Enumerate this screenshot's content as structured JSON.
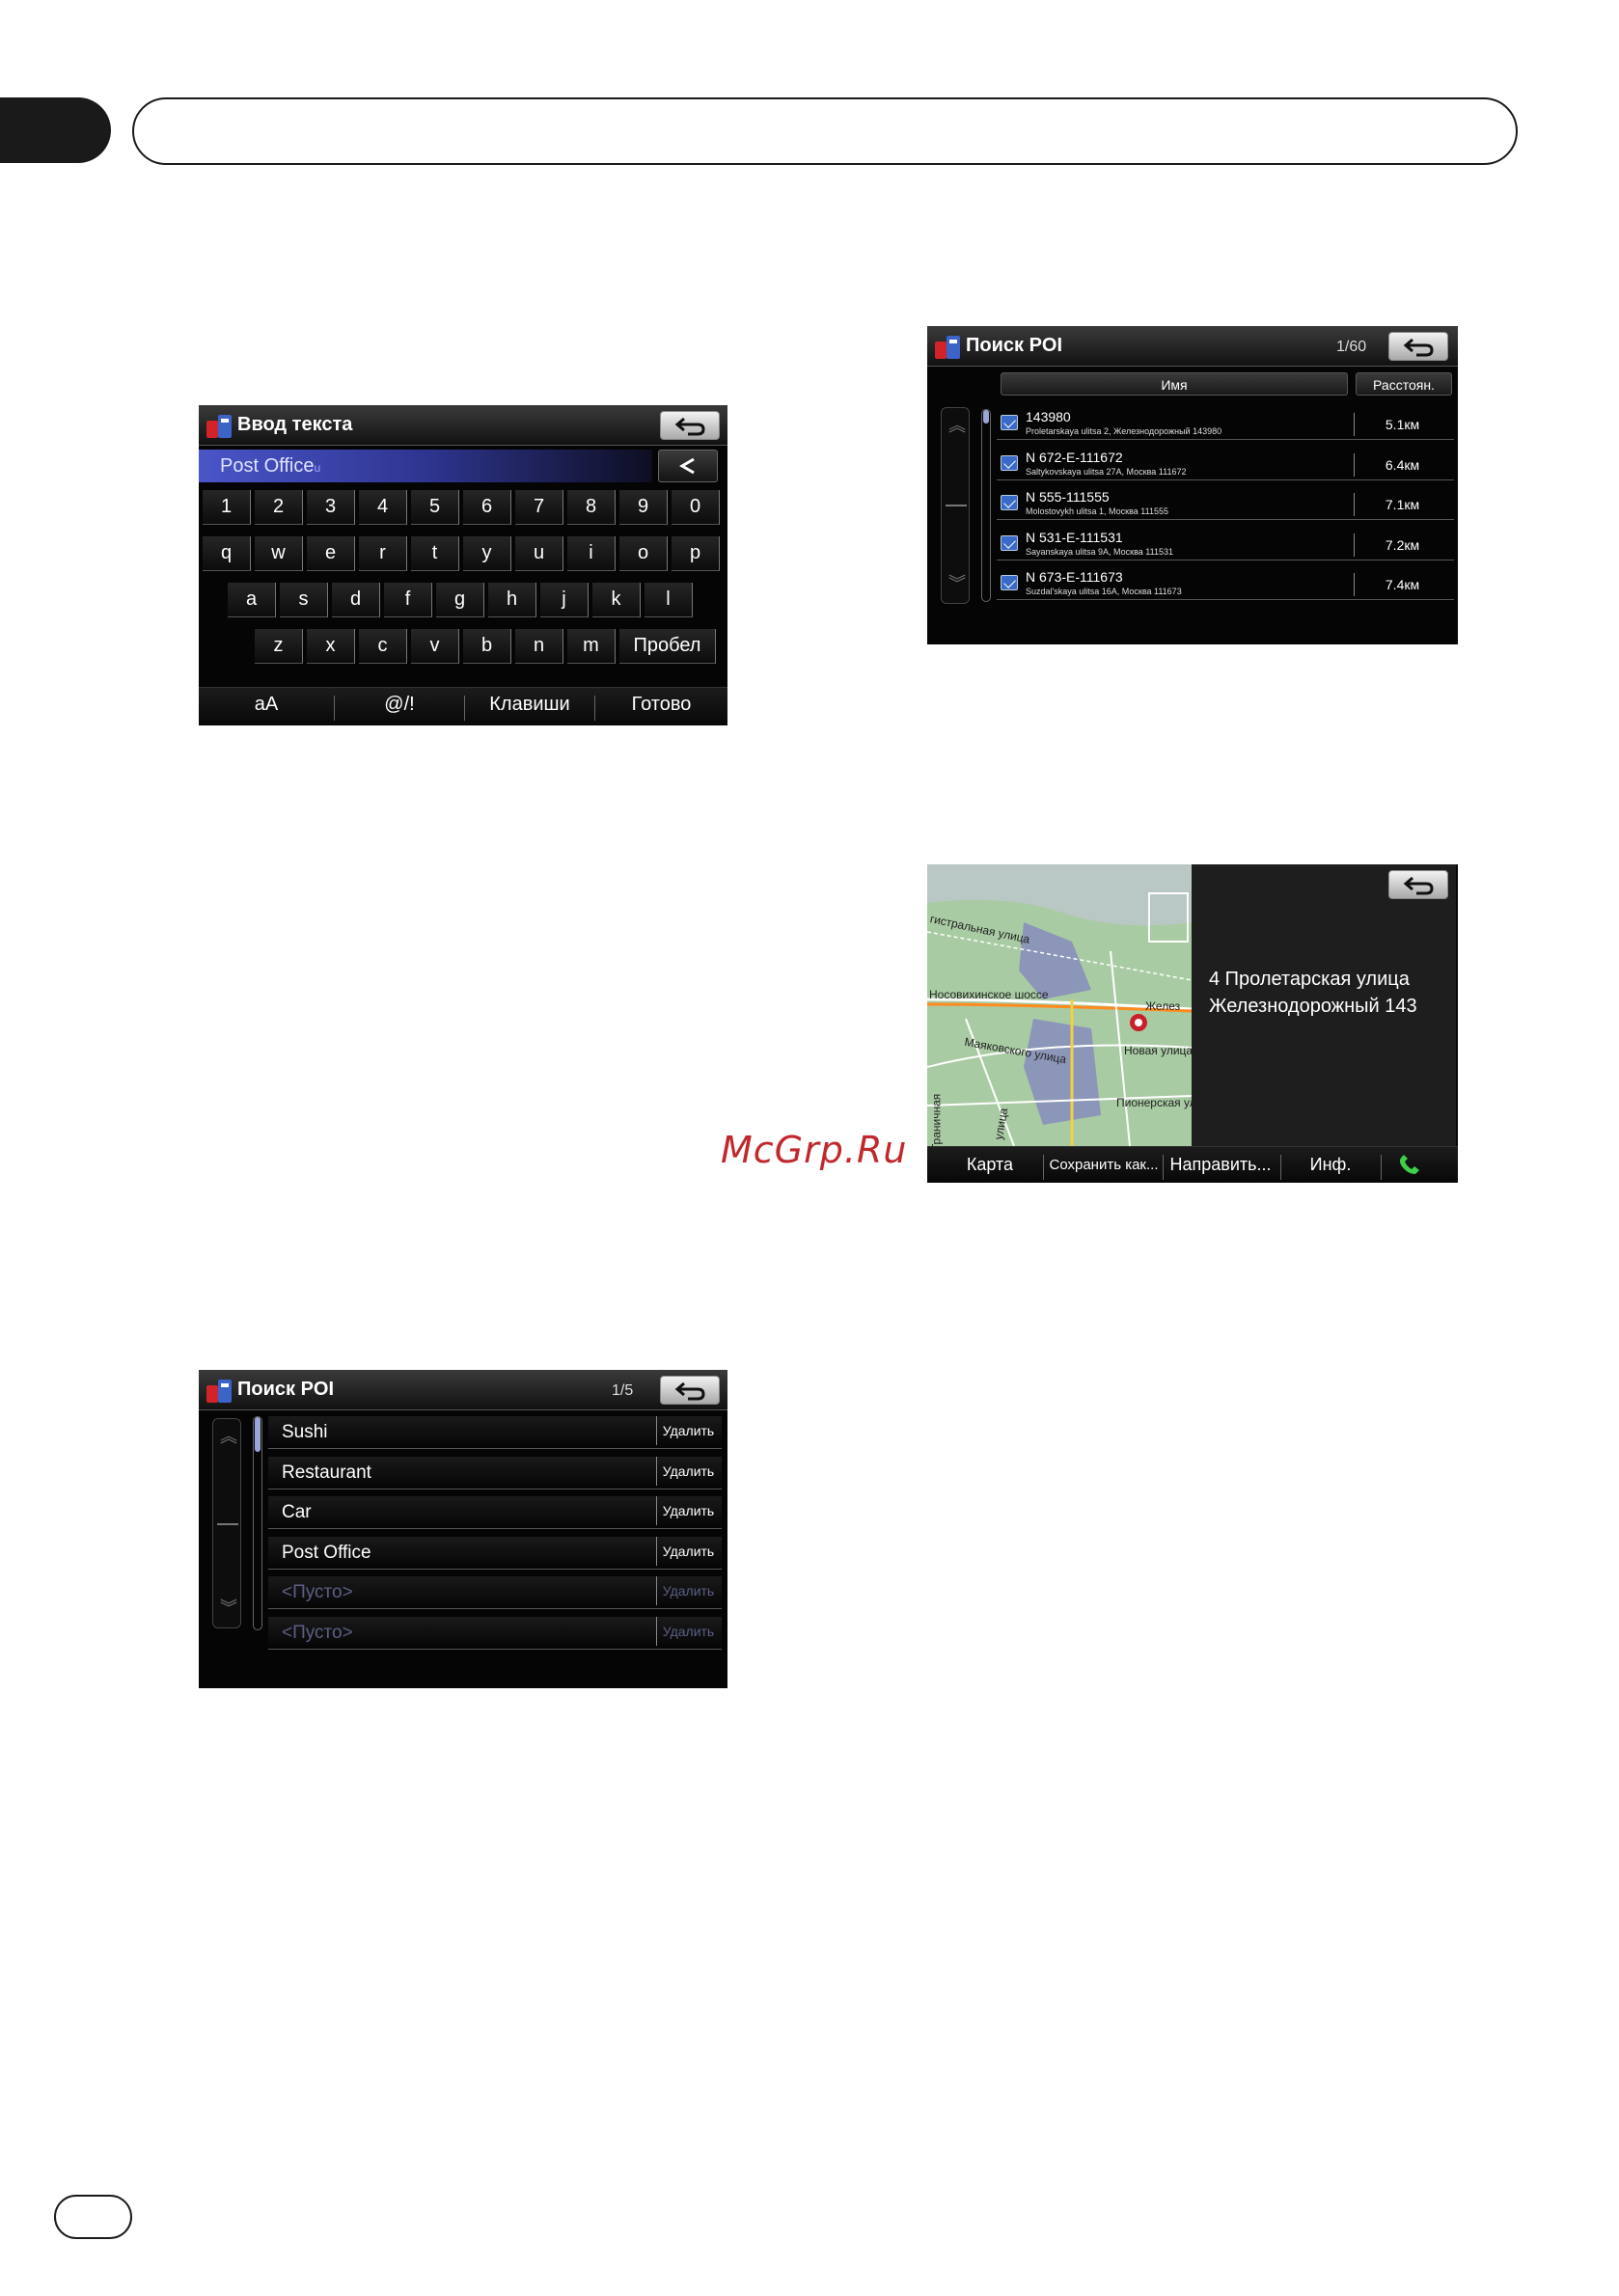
{
  "watermark": "McGrp.Ru",
  "keyboard_screen": {
    "title": "Ввод текста",
    "input_value": "Post Office",
    "rows": [
      [
        "1",
        "2",
        "3",
        "4",
        "5",
        "6",
        "7",
        "8",
        "9",
        "0"
      ],
      [
        "q",
        "w",
        "e",
        "r",
        "t",
        "y",
        "u",
        "i",
        "o",
        "p"
      ],
      [
        "a",
        "s",
        "d",
        "f",
        "g",
        "h",
        "j",
        "k",
        "l"
      ],
      [
        "z",
        "x",
        "c",
        "v",
        "b",
        "n",
        "m"
      ]
    ],
    "space_label": "Пробел",
    "bottom_buttons": [
      "aA",
      "@/!",
      "Клавиши",
      "Готово"
    ]
  },
  "poi_history_screen": {
    "title": "Поиск POI",
    "counter": "1/5",
    "delete_label": "Удалить",
    "items": [
      {
        "name": "Sushi",
        "empty": false
      },
      {
        "name": "Restaurant",
        "empty": false
      },
      {
        "name": "Car",
        "empty": false
      },
      {
        "name": "Post Office",
        "empty": false
      },
      {
        "name": "<Пусто>",
        "empty": true
      },
      {
        "name": "<Пусто>",
        "empty": true
      }
    ]
  },
  "poi_results_screen": {
    "title": "Поиск POI",
    "counter": "1/60",
    "columns": {
      "name": "Имя",
      "distance": "Расстоян."
    },
    "rows": [
      {
        "id": "143980",
        "address": "Proletarskaya ulitsa 2, Железнодорожный 143980",
        "distance": "5.1км"
      },
      {
        "id": "N 672-E-111672",
        "address": "Saltykovskaya ulitsa 27A, Москва 111672",
        "distance": "6.4км"
      },
      {
        "id": "N 555-111555",
        "address": "Molostovykh ulitsa 1, Москва 111555",
        "distance": "7.1км"
      },
      {
        "id": "N 531-E-111531",
        "address": "Sayanskaya ulitsa 9A, Москва 111531",
        "distance": "7.2км"
      },
      {
        "id": "N 673-E-111673",
        "address": "Suzdal'skaya ulitsa 16A, Москва 111673",
        "distance": "7.4км"
      }
    ]
  },
  "map_screen": {
    "address_line1": "4 Пролетарская улица",
    "address_line2": "Железнодорожный 143",
    "labels": {
      "highway": "Носовихинское шоссе",
      "magistral": "гистральная улица",
      "mayakovsky": "Маяковского улица",
      "novaya": "Новая улица",
      "pionerskaya": "Пионерская улица",
      "granichnaya": "Граничная",
      "ulitsa": "улица",
      "zhelez": "Желез"
    },
    "bottom_buttons": [
      "Карта",
      "Сохранить как...",
      "Направить...",
      "Инф."
    ]
  }
}
